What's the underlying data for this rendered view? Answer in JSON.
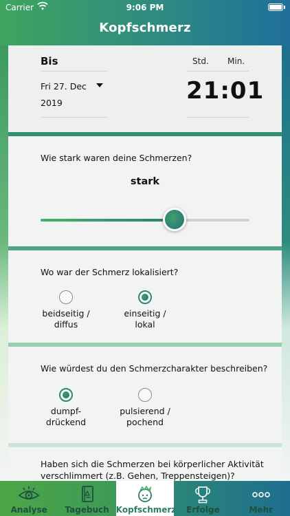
{
  "status": {
    "carrier": "Carrier",
    "time": "9:06 PM"
  },
  "nav": {
    "title": "Kopfschmerz"
  },
  "date_section": {
    "label": "Bis",
    "date_line1": "Fri 27. Dec",
    "date_line2": "2019",
    "hours_label": "Std.",
    "minutes_label": "Min.",
    "time_value": "21:01"
  },
  "strength": {
    "question": "Wie stark waren deine Schmerzen?",
    "value_label": "stark",
    "slider_fraction": 0.64
  },
  "location": {
    "question": "Wo war der Schmerz lokalisiert?",
    "options": [
      {
        "line1": "beidseitig /",
        "line2": "diffus",
        "checked": false
      },
      {
        "line1": "einseitig /",
        "line2": "lokal",
        "checked": true
      }
    ]
  },
  "character": {
    "question": "Wie würdest du den Schmerzcharakter beschreiben?",
    "options": [
      {
        "line1": "dumpf-",
        "line2": "drückend",
        "checked": true
      },
      {
        "line1": "pulsierend /",
        "line2": "pochend",
        "checked": false
      }
    ]
  },
  "activity": {
    "question_line1": "Haben sich die Schmerzen bei körperlicher Aktivität",
    "question_line2": "verschlimmert (z.B. Gehen, Treppensteigen)?"
  },
  "tabs": [
    {
      "label": "Analyse",
      "icon": "eye-icon",
      "active": false
    },
    {
      "label": "Tagebuch",
      "icon": "book-icon",
      "active": false
    },
    {
      "label": "Kopfschmerz",
      "icon": "head-icon",
      "active": true
    },
    {
      "label": "Erfolge",
      "icon": "trophy-icon",
      "active": false
    },
    {
      "label": "Mehr",
      "icon": "more-icon",
      "active": false
    }
  ],
  "colors": {
    "accent_green": "#3da55e",
    "accent_teal": "#2c7f74",
    "accent_blue": "#1f6f9a"
  }
}
